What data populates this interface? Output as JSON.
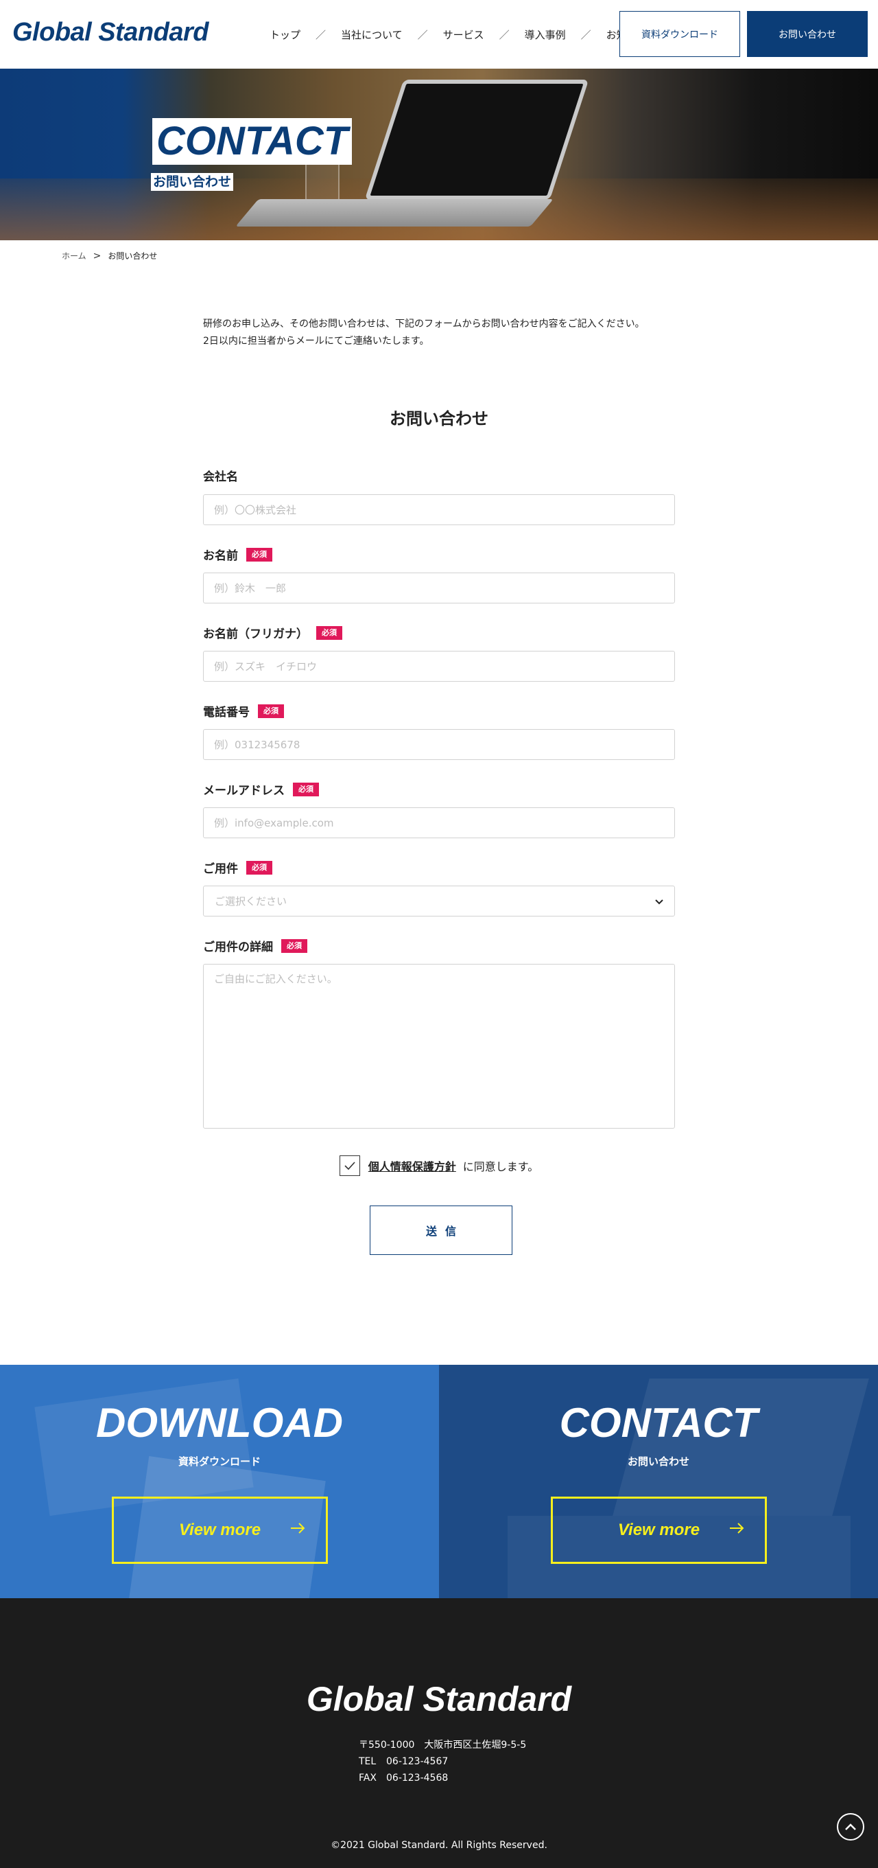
{
  "header": {
    "logo": "Global Standard",
    "nav": [
      "トップ",
      "当社について",
      "サービス",
      "導入事例",
      "お知らせ"
    ],
    "nav_separator": "／",
    "download_btn": "資料ダウンロード",
    "contact_btn": "お問い合わせ"
  },
  "hero": {
    "title": "CONTACT",
    "subtitle": "お問い合わせ"
  },
  "breadcrumb": {
    "home": "ホーム",
    "separator": ">",
    "current": "お問い合わせ"
  },
  "intro": {
    "line1": "研修のお申し込み、その他お問い合わせは、下記のフォームからお問い合わせ内容をご記入ください。",
    "line2": "2日以内に担当者からメールにてご連絡いたします。"
  },
  "form": {
    "title": "お問い合わせ",
    "required_badge": "必須",
    "fields": {
      "company": {
        "label": "会社名",
        "placeholder": "例）〇〇株式会社"
      },
      "name": {
        "label": "お名前",
        "placeholder": "例）鈴木　一郎"
      },
      "kana": {
        "label": "お名前（フリガナ）",
        "placeholder": "例）スズキ　イチロウ"
      },
      "phone": {
        "label": "電話番号",
        "placeholder": "例）0312345678"
      },
      "email": {
        "label": "メールアドレス",
        "placeholder": "例）info@example.com"
      },
      "subject": {
        "label": "ご用件",
        "placeholder": "ご選択ください"
      },
      "detail": {
        "label": "ご用件の詳細",
        "placeholder": "ご自由にご記入ください。"
      }
    },
    "agree_link": "個人情報保護方針",
    "agree_text": "に同意します。",
    "submit": "送信"
  },
  "cta": {
    "download": {
      "title": "DOWNLOAD",
      "subtitle": "資料ダウンロード",
      "button": "View more"
    },
    "contact": {
      "title": "CONTACT",
      "subtitle": "お問い合わせ",
      "button": "View more"
    }
  },
  "footer": {
    "logo": "Global Standard",
    "address": "〒550-1000　大阪市西区土佐堀9-5-5",
    "tel_label": "TEL",
    "tel": "06-123-4567",
    "fax_label": "FAX",
    "fax": "06-123-4568",
    "copyright": "©2021 Global Standard. All Rights Reserved."
  },
  "colors": {
    "brand": "#0b3d77",
    "required": "#e0195a",
    "cta_accent": "#f7ef1d",
    "footer_bg": "#1c1c1c"
  }
}
